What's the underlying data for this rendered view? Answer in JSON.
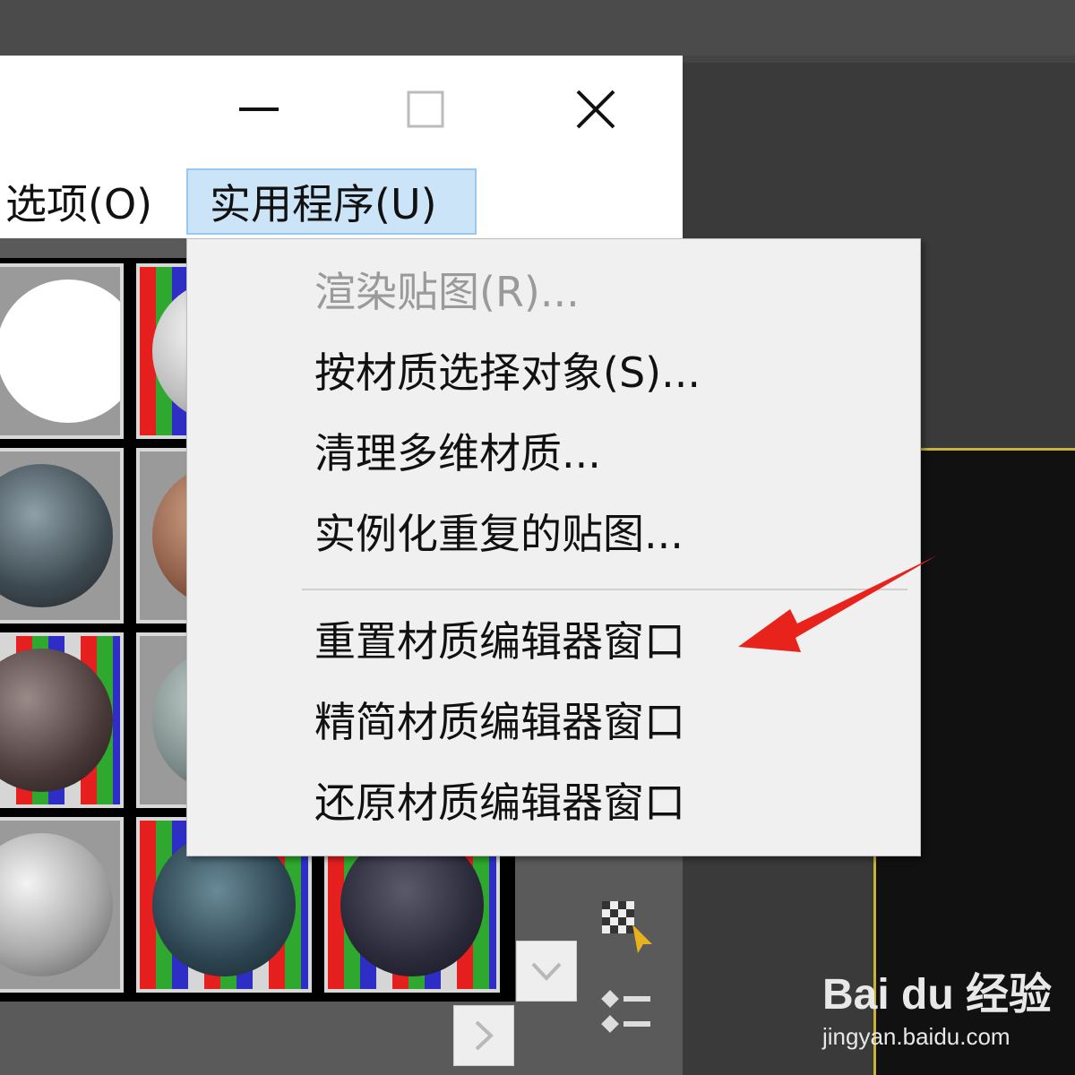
{
  "window": {
    "controls": {
      "minimize": "minimize-icon",
      "maximize": "maximize-icon",
      "close": "close-icon"
    },
    "menubar": [
      {
        "label": "选项(O)",
        "active": false
      },
      {
        "label": "实用程序(U)",
        "active": true
      }
    ]
  },
  "dropdown": {
    "items": [
      {
        "label": "渲染贴图(R)...",
        "disabled": true
      },
      {
        "label": "按材质选择对象(S)...",
        "disabled": false
      },
      {
        "label": "清理多维材质...",
        "disabled": false
      },
      {
        "label": "实例化重复的贴图...",
        "disabled": false
      },
      {
        "label": "重置材质编辑器窗口",
        "disabled": false,
        "highlighted_by_arrow": true
      },
      {
        "label": "精简材质编辑器窗口",
        "disabled": false
      },
      {
        "label": "还原材质编辑器窗口",
        "disabled": false
      }
    ]
  },
  "colors": {
    "menu_active_bg": "#cce4f7",
    "menu_active_border": "#99c9ef",
    "arrow": "#e8231c",
    "viewport_border": "#c9b23a"
  },
  "icons": {
    "scroll_down": "chevron-down-icon",
    "scroll_right": "chevron-right-icon",
    "pick_material": "checker-pick-icon",
    "options_list": "options-list-icon"
  },
  "watermark": {
    "logo": "Bai du 经验",
    "url": "jingyan.baidu.com"
  }
}
